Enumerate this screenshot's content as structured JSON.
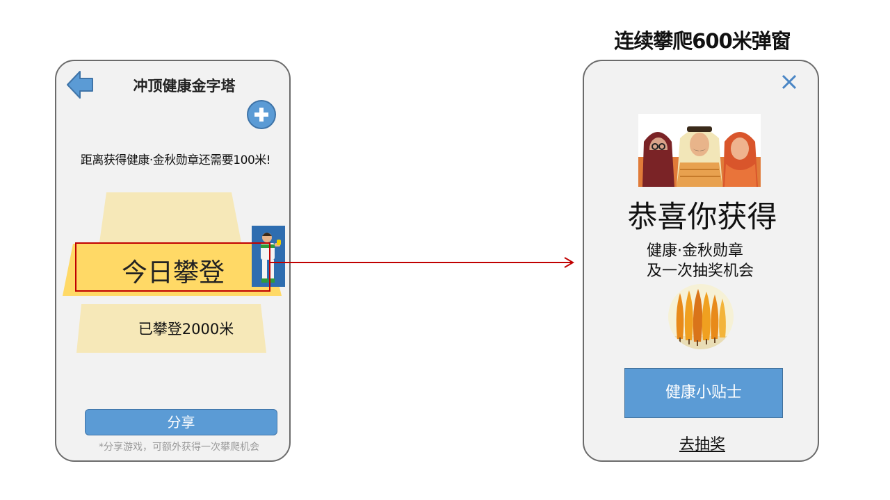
{
  "left_screen": {
    "title": "冲顶健康金字塔",
    "progress_text": "距离获得健康·金秋勋章还需要100米!",
    "today_climb_label": "今日攀登",
    "climbed_label": "已攀登2000米",
    "share_button_label": "分享",
    "share_hint": "*分享游戏，可额外获得一次攀爬机会",
    "icons": {
      "back": "back-arrow-icon",
      "add": "plus-circle-icon",
      "avatar": "climber-avatar-icon"
    }
  },
  "popup": {
    "heading": "连续攀爬600米弹窗",
    "congrats_text": "恭喜你获得",
    "reward_line1": "健康·金秋勋章",
    "reward_line2": "及一次抽奖机会",
    "tips_button_label": "健康小贴士",
    "lottery_link_label": "去抽奖",
    "icons": {
      "close": "close-icon"
    }
  },
  "colors": {
    "accent_blue": "#5b9bd5",
    "highlight_red": "#c00000",
    "pyramid_light": "#f6e8b8",
    "pyramid_active": "#ffd966",
    "phone_bg": "#f2f2f2"
  }
}
